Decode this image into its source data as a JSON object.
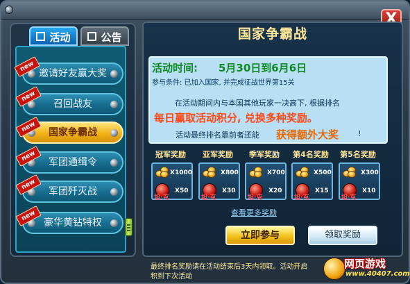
{
  "window": {
    "close_glyph": "X"
  },
  "tabs": {
    "activity": "活动",
    "notice": "公告"
  },
  "sidebar": {
    "items": [
      {
        "label": "邀请好友赢大奖",
        "badge": "new"
      },
      {
        "label": "召回战友",
        "badge": "new"
      },
      {
        "label": "国家争霸战",
        "badge": "new",
        "active": true
      },
      {
        "label": "军团通缉令",
        "badge": "new"
      },
      {
        "label": "军团歼灭战",
        "badge": "new"
      },
      {
        "label": "豪华黄钻特权",
        "badge": "new"
      }
    ]
  },
  "main": {
    "title": "国家争霸战",
    "time_label": "活动时间:",
    "time_value": "5月30日到6月6日",
    "condition": "参与条件: 已加入国家, 并完成征战世界第15关",
    "desc_line1": "在活动期间内与本国其他玩家一决高下, 根据排名",
    "desc_line2": "每日赢取活动积分, 兑换多种奖励。",
    "desc_line3_prefix": "活动最终排名靠前者还能",
    "desc_line3_highlight": "获得额外大奖",
    "desc_line3_suffix": "!",
    "ranks": [
      {
        "label": "冠军奖励",
        "coins": "X1000",
        "gifts": "X50",
        "gift_tag": "坦·克"
      },
      {
        "label": "亚军奖励",
        "coins": "X800",
        "gifts": "X30",
        "gift_tag": "坦·克"
      },
      {
        "label": "季军奖励",
        "coins": "X700",
        "gifts": "X20",
        "gift_tag": "坦·克"
      },
      {
        "label": "第4名奖励",
        "coins": "X500",
        "gifts": "X15",
        "gift_tag": "坦·克"
      },
      {
        "label": "第5名奖励",
        "coins": "X300",
        "gifts": "X10",
        "gift_tag": "坦·克"
      }
    ],
    "more_rewards": "查看更多奖励",
    "join_button": "立即参与",
    "claim_button": "领取奖励",
    "footer_line1": "最终排名奖励请在活动结束后3天内领取。活动开启",
    "footer_line2": "积到下次活动"
  },
  "watermark": {
    "name": "网页游戏",
    "url": "www.40407.com"
  },
  "colors": {
    "accent_gold": "#ffe79a",
    "time_green": "#0f8a26",
    "highlight_orange": "#ff4a18"
  },
  "icons": [
    "close-icon",
    "coin-icon",
    "gift-bag-icon",
    "knob-icon",
    "scroll-thumb-icon"
  ]
}
